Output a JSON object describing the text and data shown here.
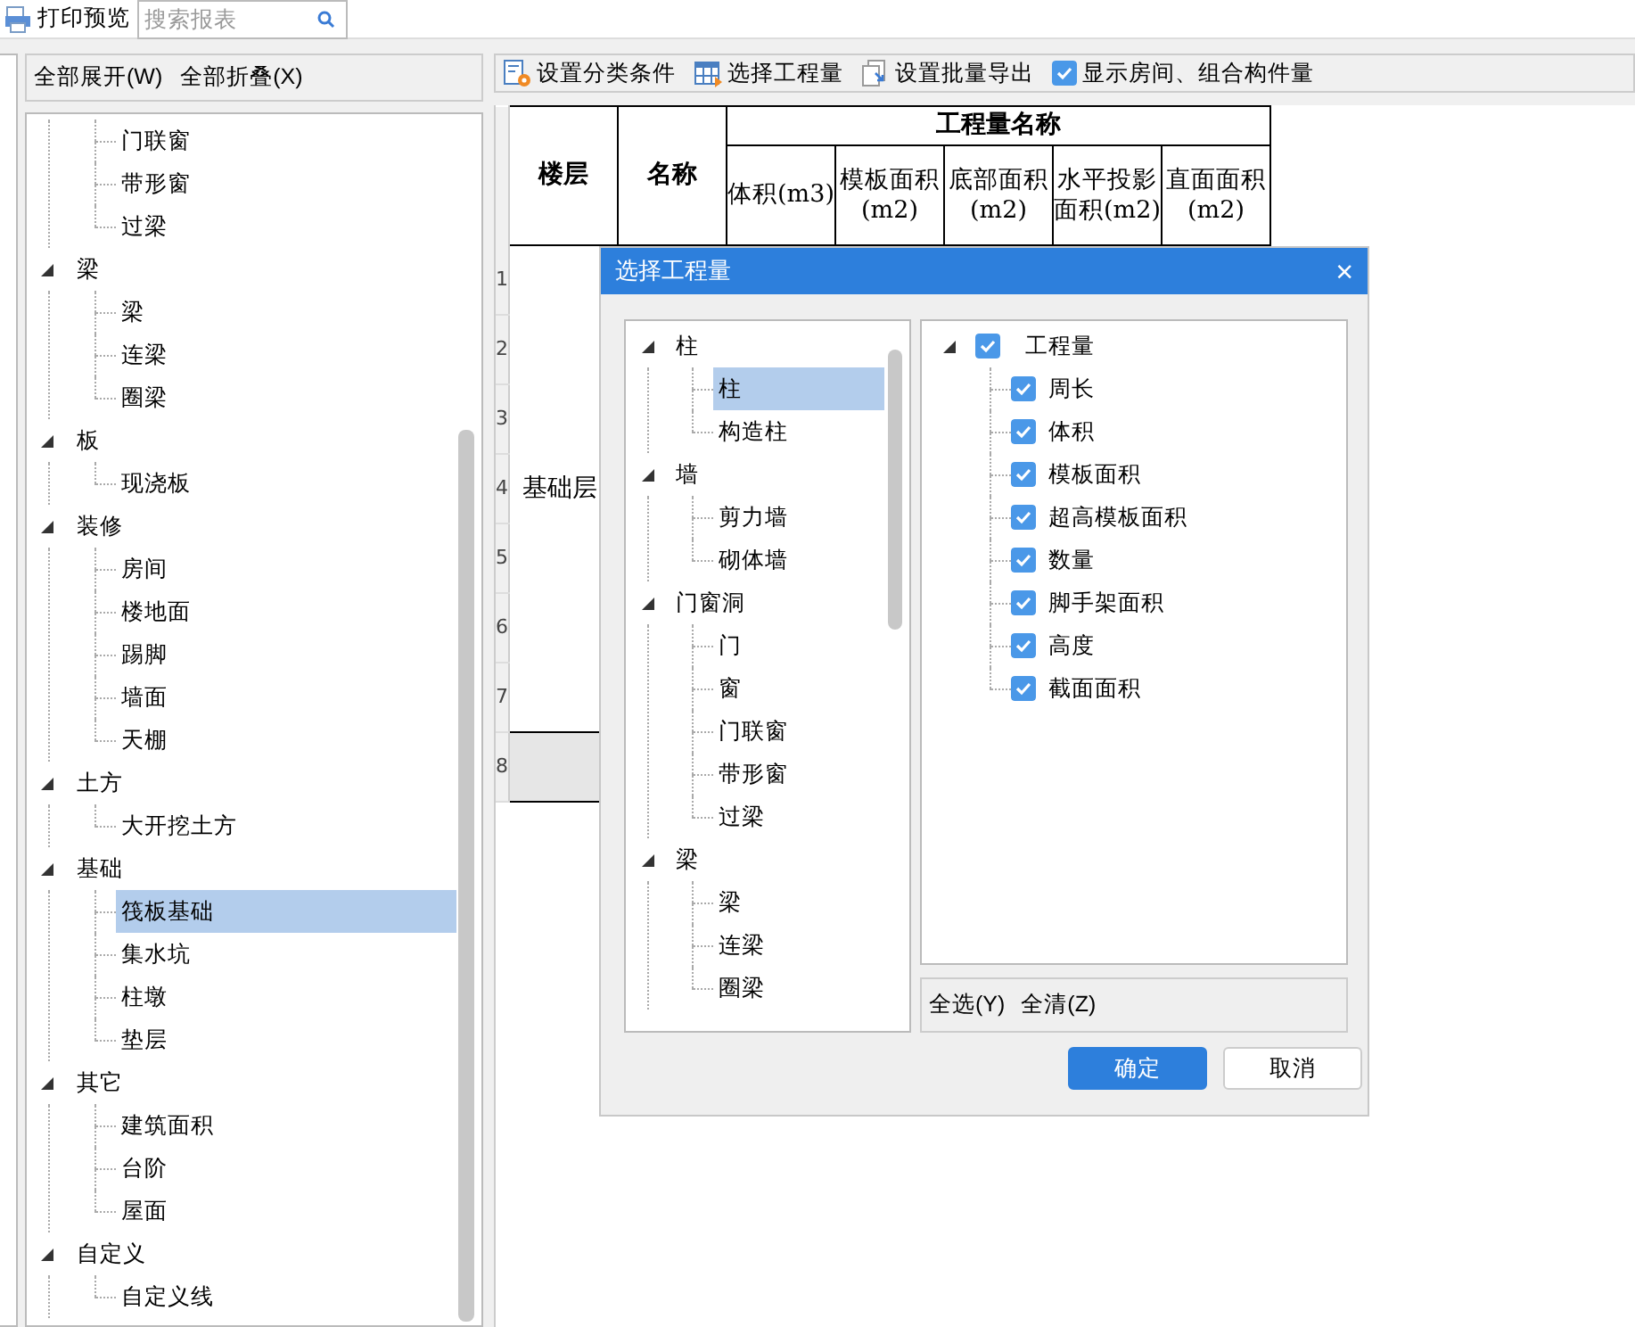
{
  "toolbar": {
    "print_label": "打印预览",
    "search": {
      "placeholder": "搜索报表"
    }
  },
  "left_panel": {
    "actions": [
      "全部展开(W)",
      "全部折叠(X)"
    ],
    "tree": [
      {
        "children": [
          {
            "label": "门联窗",
            "selected": false
          },
          {
            "label": "带形窗",
            "selected": false
          },
          {
            "label": "过梁",
            "selected": false
          }
        ]
      },
      {
        "label": "梁",
        "expanded": true,
        "selected": false,
        "children": [
          {
            "label": "梁",
            "selected": false
          },
          {
            "label": "连梁",
            "selected": false
          },
          {
            "label": "圈梁",
            "selected": false
          }
        ]
      },
      {
        "label": "板",
        "expanded": true,
        "selected": false,
        "children": [
          {
            "label": "现浇板",
            "selected": false
          }
        ]
      },
      {
        "label": "装修",
        "expanded": true,
        "selected": false,
        "children": [
          {
            "label": "房间",
            "selected": false
          },
          {
            "label": "楼地面",
            "selected": false
          },
          {
            "label": "踢脚",
            "selected": false
          },
          {
            "label": "墙面",
            "selected": false
          },
          {
            "label": "天棚",
            "selected": false
          }
        ]
      },
      {
        "label": "土方",
        "expanded": true,
        "selected": false,
        "children": [
          {
            "label": "大开挖土方",
            "selected": false
          }
        ]
      },
      {
        "label": "基础",
        "expanded": true,
        "selected": false,
        "children": [
          {
            "label": "筏板基础",
            "selected": true
          },
          {
            "label": "集水坑",
            "selected": false
          },
          {
            "label": "柱墩",
            "selected": false
          },
          {
            "label": "垫层",
            "selected": false
          }
        ]
      },
      {
        "label": "其它",
        "expanded": true,
        "selected": false,
        "children": [
          {
            "label": "建筑面积",
            "selected": false
          },
          {
            "label": "台阶",
            "selected": false
          },
          {
            "label": "屋面",
            "selected": false
          }
        ]
      },
      {
        "label": "自定义",
        "expanded": true,
        "selected": false,
        "children": [
          {
            "label": "自定义线",
            "selected": false
          }
        ]
      }
    ]
  },
  "report_toolbar": {
    "items": [
      {
        "kind": "settings",
        "label": "设置分类条件"
      },
      {
        "kind": "table",
        "label": "选择工程量"
      },
      {
        "kind": "export",
        "label": "设置批量导出"
      },
      {
        "kind": "checkbox",
        "label": "显示房间、组合构件量",
        "checked": true
      }
    ]
  },
  "table": {
    "columns": [
      "楼层",
      "名称"
    ],
    "group_header": "工程量名称",
    "sub_columns": [
      "体积(m3)",
      "模板面积(m2)",
      "底部面积(m2)",
      "水平投影面积(m2)",
      "直面面积(m2)"
    ],
    "row_numbers": [
      "1",
      "2",
      "3",
      "4",
      "5",
      "6",
      "7",
      "8"
    ],
    "floor": "基础层"
  },
  "dialog": {
    "title": "选择工程量",
    "close": "×",
    "left_tree": [
      {
        "label": "柱",
        "expanded": true,
        "selected": false,
        "children": [
          {
            "label": "柱",
            "selected": true
          },
          {
            "label": "构造柱",
            "selected": false
          }
        ]
      },
      {
        "label": "墙",
        "expanded": true,
        "selected": false,
        "children": [
          {
            "label": "剪力墙",
            "selected": false
          },
          {
            "label": "砌体墙",
            "selected": false
          }
        ]
      },
      {
        "label": "门窗洞",
        "expanded": true,
        "selected": false,
        "children": [
          {
            "label": "门",
            "selected": false
          },
          {
            "label": "窗",
            "selected": false
          },
          {
            "label": "门联窗",
            "selected": false
          },
          {
            "label": "带形窗",
            "selected": false
          },
          {
            "label": "过梁",
            "selected": false
          }
        ]
      },
      {
        "label": "梁",
        "expanded": true,
        "selected": false,
        "children": [
          {
            "label": "梁",
            "selected": false
          },
          {
            "label": "连梁",
            "selected": false
          },
          {
            "label": "圈梁",
            "selected": false
          }
        ]
      }
    ],
    "right_tree": {
      "label": "工程量",
      "expanded": true,
      "checked": true,
      "children": [
        {
          "label": "周长",
          "checked": true
        },
        {
          "label": "体积",
          "checked": true
        },
        {
          "label": "模板面积",
          "checked": true
        },
        {
          "label": "超高模板面积",
          "checked": true
        },
        {
          "label": "数量",
          "checked": true
        },
        {
          "label": "脚手架面积",
          "checked": true
        },
        {
          "label": "高度",
          "checked": true
        },
        {
          "label": "截面面积",
          "checked": true
        }
      ]
    },
    "footer_actions": [
      "全选(Y)",
      "全清(Z)"
    ],
    "buttons": [
      {
        "label": "确定",
        "kind": "primary"
      },
      {
        "label": "取消",
        "kind": "secondary"
      }
    ]
  }
}
